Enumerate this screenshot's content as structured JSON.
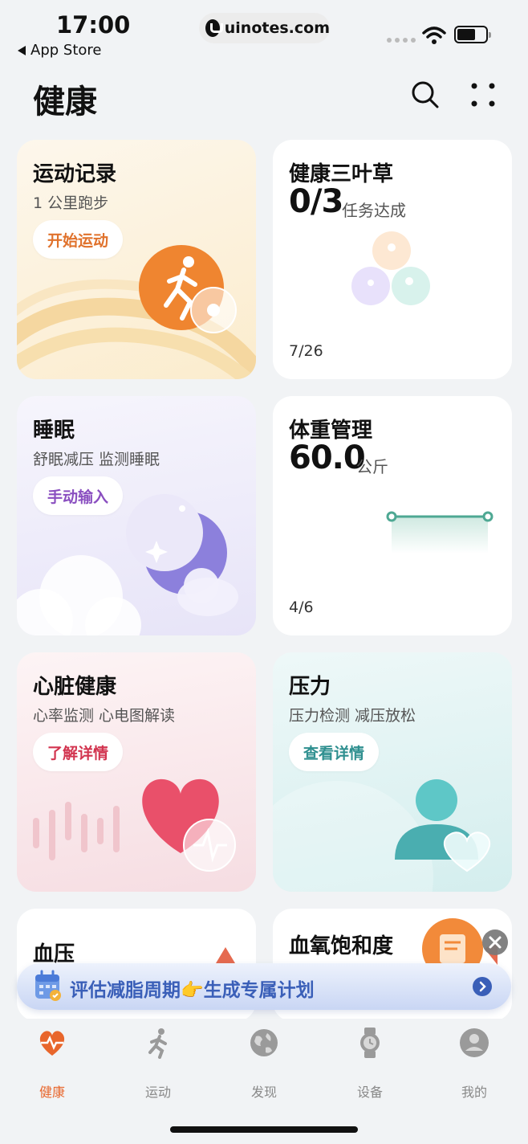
{
  "status_bar": {
    "time": "17:00",
    "back_app": "App Store",
    "url": "uinotes.com"
  },
  "header": {
    "title": "健康",
    "search_icon": "search-icon",
    "more_icon": "grid-dots-icon"
  },
  "cards": {
    "exercise": {
      "title": "运动记录",
      "subtitle": "1 公里跑步",
      "button": "开始运动",
      "accent": "#e0722c"
    },
    "clover": {
      "title": "健康三叶草",
      "value": "0/3",
      "value_label": "任务达成",
      "date": "7/26"
    },
    "sleep": {
      "title": "睡眠",
      "subtitle": "舒眠减压 监测睡眠",
      "button": "手动输入",
      "accent": "#8a4fc0"
    },
    "weight": {
      "title": "体重管理",
      "value": "60.0",
      "unit": "公斤",
      "date": "4/6",
      "accent": "#4ea893"
    },
    "heart": {
      "title": "心脏健康",
      "subtitle": "心率监测 心电图解读",
      "button": "了解详情",
      "accent": "#d2344f"
    },
    "stress": {
      "title": "压力",
      "subtitle": "压力检测 减压放松",
      "button": "查看详情",
      "accent": "#2e8f8f"
    },
    "bp": {
      "title": "血压"
    },
    "spo2": {
      "title": "血氧饱和度"
    }
  },
  "banner": {
    "text": "评估减脂周期👉生成专属计划",
    "accent": "#3a5fb8"
  },
  "tabbar": {
    "items": [
      {
        "label": "健康",
        "icon": "heart-pulse-icon",
        "active": true
      },
      {
        "label": "运动",
        "icon": "runner-icon",
        "active": false
      },
      {
        "label": "发现",
        "icon": "globe-icon",
        "active": false
      },
      {
        "label": "设备",
        "icon": "watch-icon",
        "active": false
      },
      {
        "label": "我的",
        "icon": "profile-icon",
        "active": false
      }
    ],
    "active_color": "#e8662c"
  }
}
